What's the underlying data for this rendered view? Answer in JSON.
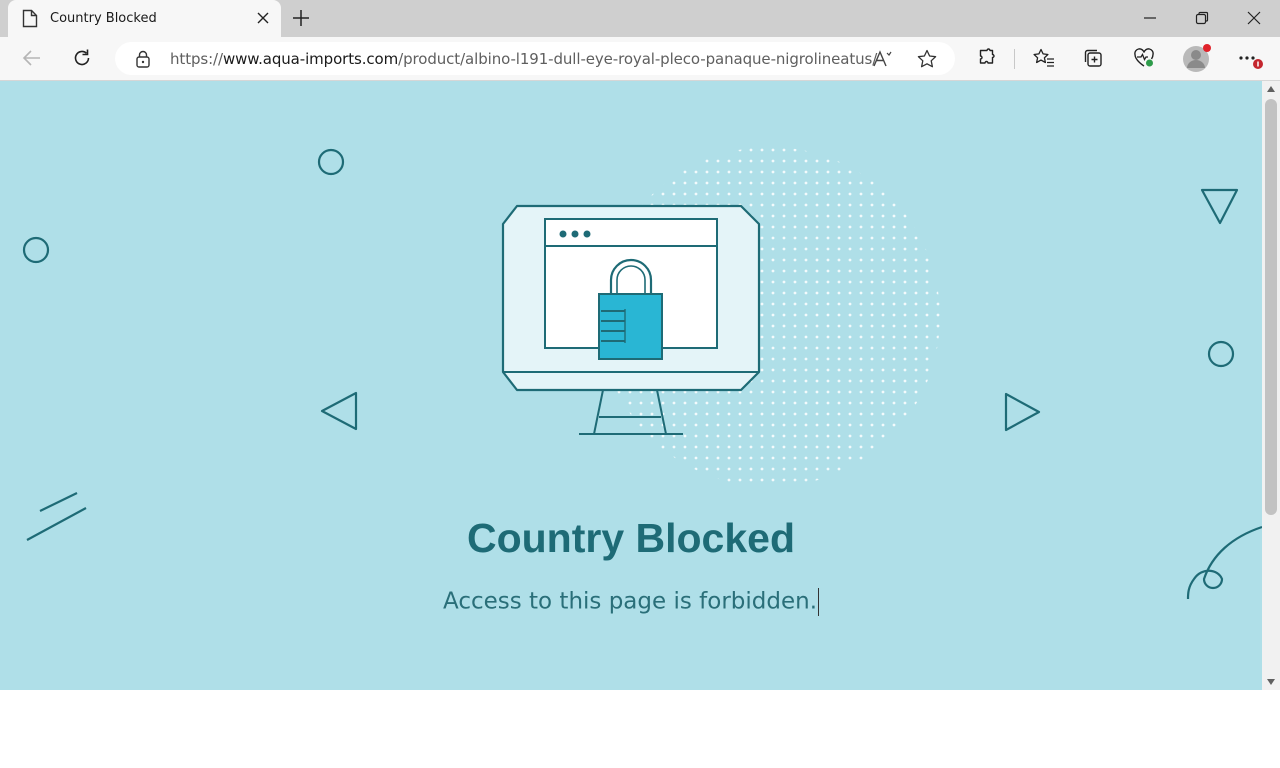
{
  "tab": {
    "title": "Country Blocked"
  },
  "address_bar": {
    "url_prefix": "https://",
    "url_host": "www.aqua-imports.com",
    "url_path": "/product/albino-l191-dull-eye-royal-pleco-panaque-nigrolineatus/",
    "read_aloud_label": "Aₓ"
  },
  "page": {
    "heading": "Country Blocked",
    "message": "Access to this page is forbidden."
  },
  "colors": {
    "background": "#afdfe8",
    "accent": "#1e6b76",
    "lock": "#29b6d4"
  }
}
